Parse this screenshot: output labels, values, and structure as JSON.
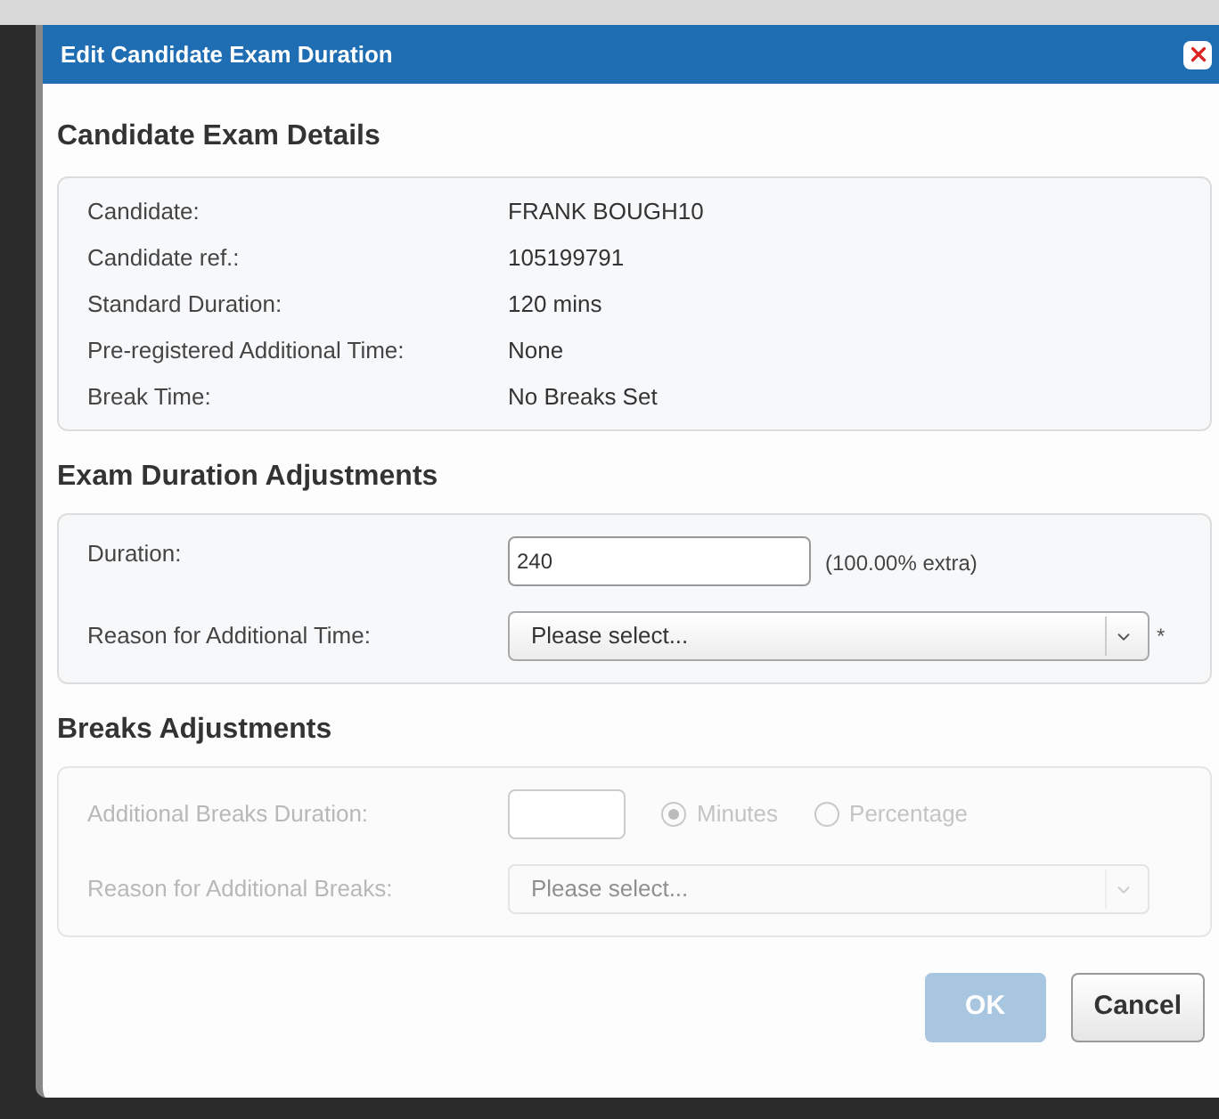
{
  "dialog": {
    "title": "Edit Candidate Exam Duration"
  },
  "details": {
    "heading": "Candidate Exam Details",
    "rows": [
      {
        "label": "Candidate:",
        "value": "FRANK BOUGH10"
      },
      {
        "label": "Candidate ref.:",
        "value": "105199791"
      },
      {
        "label": "Standard Duration:",
        "value": "120 mins"
      },
      {
        "label": "Pre-registered Additional Time:",
        "value": "None"
      },
      {
        "label": "Break Time:",
        "value": "No Breaks Set"
      }
    ]
  },
  "duration": {
    "heading": "Exam Duration Adjustments",
    "disabled": false,
    "duration_label": "Duration:",
    "duration_value": "240",
    "extra": "(100.00% extra)",
    "reason_label": "Reason for Additional Time:",
    "reason_value": "Please select...",
    "required_mark": "*"
  },
  "breaks": {
    "heading": "Breaks Adjustments",
    "disabled": true,
    "duration_label": "Additional Breaks Duration:",
    "units": [
      {
        "label": "Minutes",
        "selected": true
      },
      {
        "label": "Percentage",
        "selected": false
      }
    ],
    "reason_label": "Reason for Additional Breaks:",
    "reason_value": "Please select..."
  },
  "buttons": [
    {
      "label": "OK",
      "disabled": true
    },
    {
      "label": "Cancel",
      "disabled": false
    }
  ]
}
